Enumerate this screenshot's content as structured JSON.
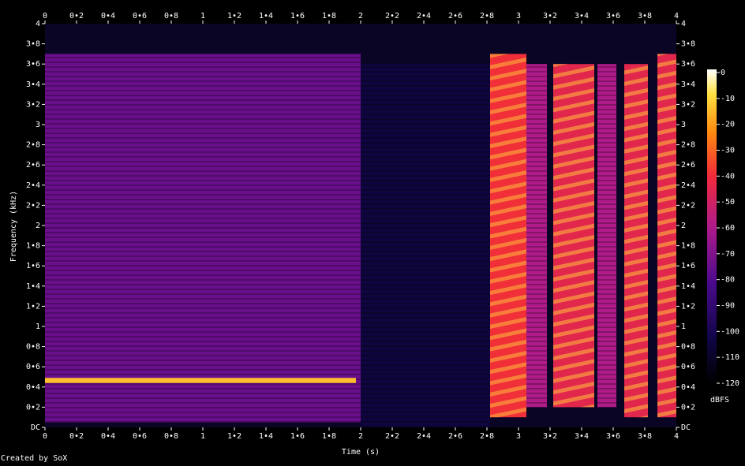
{
  "chart_data": {
    "type": "heatmap",
    "xlabel": "Time (s)",
    "ylabel": "Frequency (kHz)",
    "xlim": [
      0,
      4
    ],
    "ylim": [
      0,
      4
    ],
    "x_ticks": [
      "0",
      "0•2",
      "0•4",
      "0•6",
      "0•8",
      "1",
      "1•2",
      "1•4",
      "1•6",
      "1•8",
      "2",
      "2•2",
      "2•4",
      "2•6",
      "2•8",
      "3",
      "3•2",
      "3•4",
      "3•6",
      "3•8",
      "4"
    ],
    "y_ticks": [
      "DC",
      "0•2",
      "0•4",
      "0•6",
      "0•8",
      "1",
      "1•2",
      "1•4",
      "1•6",
      "1•8",
      "2",
      "2•2",
      "2•4",
      "2•6",
      "2•8",
      "3",
      "3•2",
      "3•4",
      "3•6",
      "3•8",
      "4"
    ],
    "colorbar": {
      "label": "dBFS",
      "ticks": [
        "0",
        "-10",
        "-20",
        "-30",
        "-40",
        "-50",
        "-60",
        "-70",
        "-80",
        "-90",
        "-100",
        "-110",
        "-120"
      ],
      "range": [
        -120,
        0
      ]
    },
    "regions": [
      {
        "t": [
          0.0,
          2.0
        ],
        "f": [
          0.05,
          3.7
        ],
        "level_dbfs": -75
      },
      {
        "t": [
          0.0,
          1.97
        ],
        "f": [
          0.44,
          0.49
        ],
        "level_dbfs": -15
      },
      {
        "t": [
          2.0,
          2.82
        ],
        "f": [
          0.0,
          3.6
        ],
        "level_dbfs": -105
      },
      {
        "t": [
          2.82,
          3.05
        ],
        "f": [
          0.1,
          3.7
        ],
        "level_dbfs": -40
      },
      {
        "t": [
          3.05,
          3.18
        ],
        "f": [
          0.2,
          3.6
        ],
        "level_dbfs": -60
      },
      {
        "t": [
          3.22,
          3.48
        ],
        "f": [
          0.2,
          3.6
        ],
        "level_dbfs": -45
      },
      {
        "t": [
          3.5,
          3.62
        ],
        "f": [
          0.2,
          3.6
        ],
        "level_dbfs": -60
      },
      {
        "t": [
          3.67,
          3.82
        ],
        "f": [
          0.1,
          3.6
        ],
        "level_dbfs": -45
      },
      {
        "t": [
          3.88,
          4.0
        ],
        "f": [
          0.1,
          3.7
        ],
        "level_dbfs": -45
      }
    ]
  },
  "credit": "Created by SoX",
  "colors": {
    "background": "#000000",
    "text": "#ffffff",
    "noise_floor": "#0a0524"
  }
}
